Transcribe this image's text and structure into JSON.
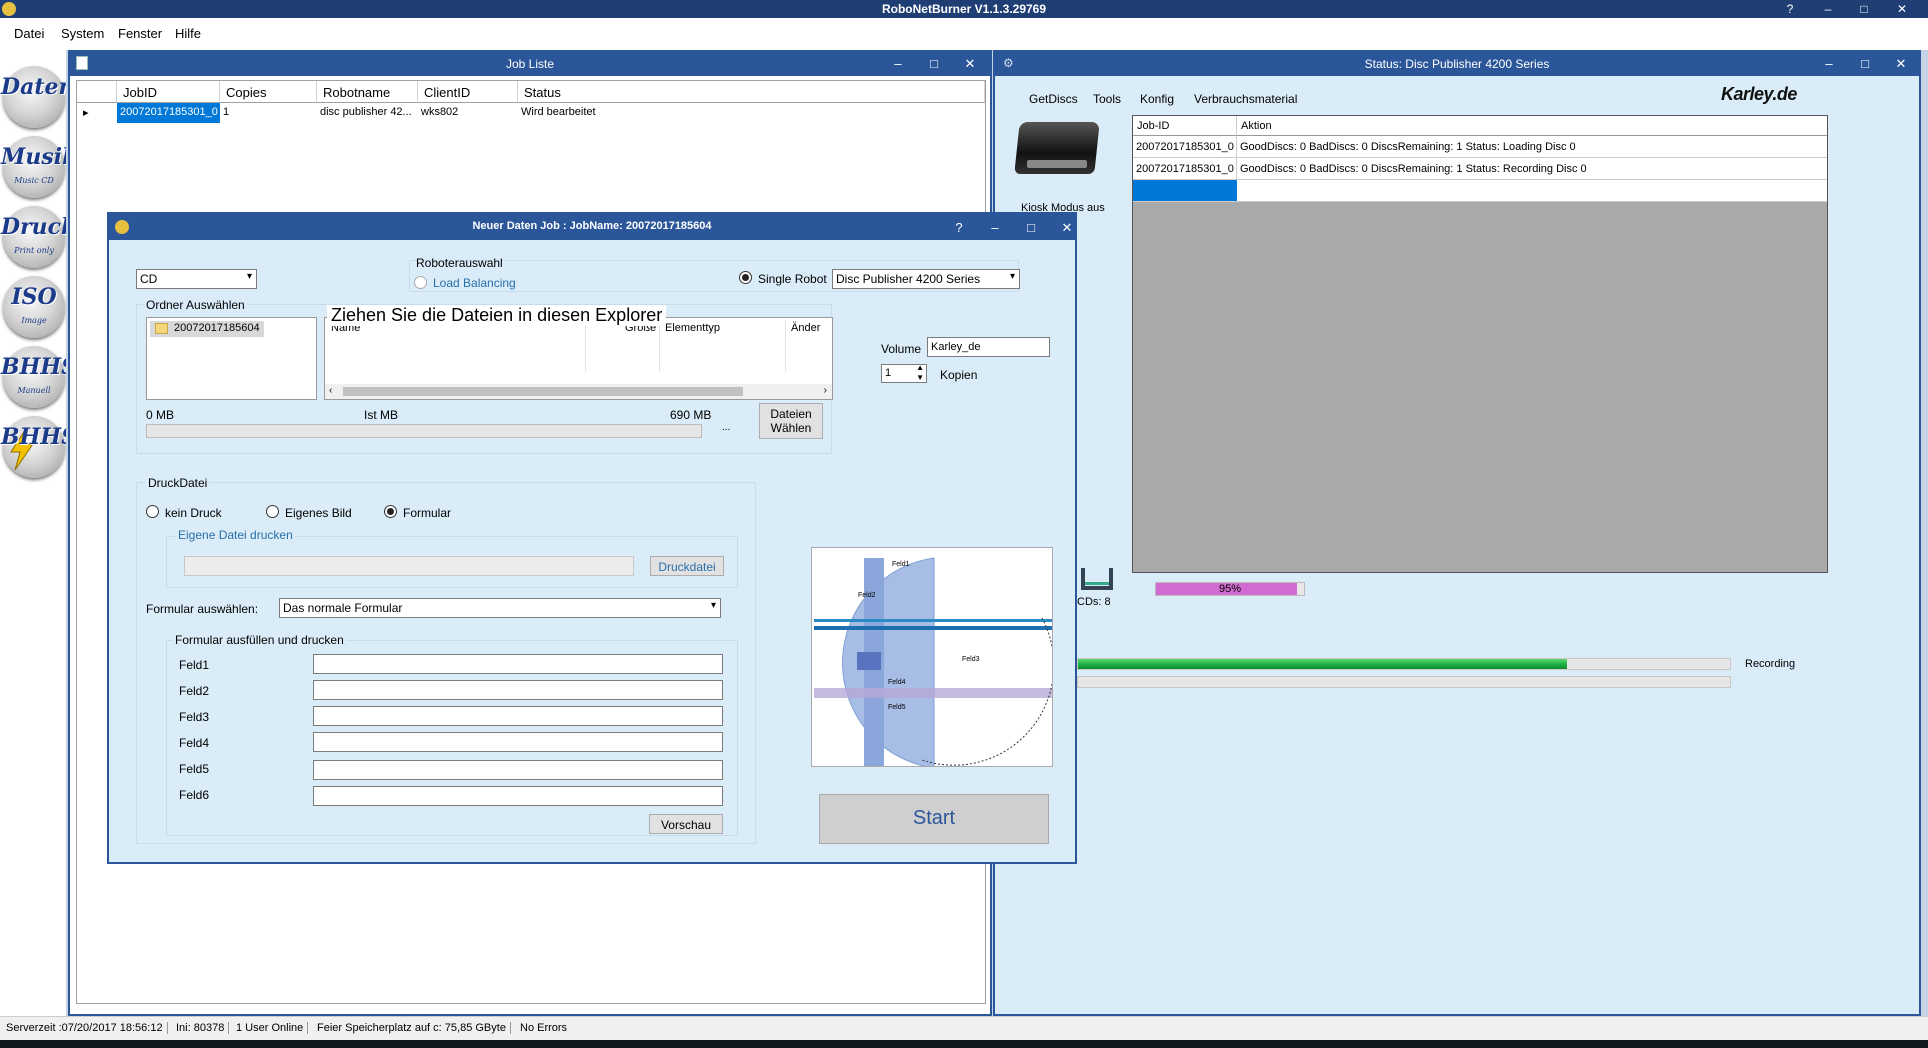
{
  "app": {
    "title": "RoboNetBurner V1.1.3.29769",
    "title_buttons": [
      "?",
      "–",
      "□",
      "✕"
    ]
  },
  "menu": [
    "Datei",
    "System",
    "Fenster",
    "Hilfe"
  ],
  "toolbar": [
    {
      "label": "Daten",
      "sub": "",
      "icon": "data-disc-icon"
    },
    {
      "label": "Musik",
      "sub": "Music CD",
      "icon": "music-disc-icon"
    },
    {
      "label": "Druck",
      "sub": "Print only",
      "icon": "print-disc-icon"
    },
    {
      "label": "ISO",
      "sub": "Image",
      "icon": "iso-disc-icon"
    },
    {
      "label": "BHHS",
      "sub": "Manuell",
      "icon": "bhhs-manual-disc-icon"
    },
    {
      "label": "BHHS",
      "sub": "",
      "icon": "bhhs-auto-disc-icon"
    }
  ],
  "joblist": {
    "title": "Job Liste",
    "columns": [
      "JobID",
      "Copies",
      "Robotname",
      "ClientID",
      "Status"
    ],
    "rows": [
      {
        "jobid": "20072017185301_0",
        "copies": "1",
        "robotname": "disc publisher 42...",
        "clientid": "wks802",
        "status": "Wird bearbeitet"
      }
    ]
  },
  "status_window": {
    "title": "Status: Disc Publisher 4200 Series",
    "menu": [
      "GetDiscs",
      "Tools",
      "Konfig",
      "Verbrauchsmaterial"
    ],
    "logo": "Karley.de",
    "kiosk_label": "Kiosk Modus aus",
    "columns": [
      "Job-ID",
      "Aktion"
    ],
    "rows": [
      {
        "jobid": "20072017185301_0",
        "aktion": "GoodDiscs: 0 BadDiscs: 0 DiscsRemaining: 1 Status: Loading Disc 0"
      },
      {
        "jobid": "20072017185301_0",
        "aktion": "GoodDiscs: 0 BadDiscs: 0 DiscsRemaining: 1 Status: Recording Disc 0"
      }
    ],
    "cds_label": "CDs: 8",
    "ink_progress_label": "95%",
    "ink_progress": 0.95,
    "recording_label": "Recording",
    "recording_progress": 0.75
  },
  "dialog": {
    "title": "Neuer Daten Job : JobName: 20072017185604",
    "title_buttons": [
      "?",
      "–",
      "□",
      "✕"
    ],
    "media_type": "CD",
    "robot_group_label": "Roboterauswahl",
    "load_balancing_label": "Load Balancing",
    "single_robot_label": "Single Robot",
    "robot_selected": "Disc Publisher 4200 Series",
    "folder_group_label": "Ordner Auswählen",
    "folder_item": "20072017185604",
    "explorer_hint": "Ziehen Sie die Dateien in diesen Explorer",
    "file_columns": [
      "Name",
      "Größe",
      "Elementtyp",
      "Änder"
    ],
    "size_min": "0 MB",
    "size_current": "Ist MB",
    "size_max": "690 MB",
    "size_ellipsis": "...",
    "dateien_button": "Dateien Wählen",
    "volume_label": "Volume",
    "volume_value": "Karley_de",
    "copies_value": "1",
    "copies_label": "Kopien",
    "print_group_label": "DruckDatei",
    "print_options": [
      "kein Druck",
      "Eigenes Bild",
      "Formular"
    ],
    "print_selected": "Formular",
    "own_file_label": "Eigene Datei drucken",
    "druckdatei_button": "Druckdatei",
    "formular_label": "Formular auswählen:",
    "formular_selected": "Das normale Formular",
    "fill_group_label": "Formular ausfüllen und drucken",
    "fields": [
      "Feld1",
      "Feld2",
      "Feld3",
      "Feld4",
      "Feld5",
      "Feld6"
    ],
    "preview_button": "Vorschau",
    "start_button": "Start",
    "preview_labels": [
      "Feld1",
      "Feld2",
      "Feld3",
      "Feld4",
      "Feld5"
    ]
  },
  "statusbar": [
    "Serverzeit :07/20/2017 18:56:12",
    "Ini: 80378",
    "1 User Online",
    "Feier Speicherplatz auf c: 75,85 GByte",
    "No Errors"
  ],
  "colors": {
    "title_dark": "#1f3f74",
    "window_title": "#2b579a",
    "dialog_bg": "#d9ecf8",
    "selection": "#0078d7",
    "recording_green": "#1fb34a",
    "ink_magenta": "#d16bd1"
  }
}
